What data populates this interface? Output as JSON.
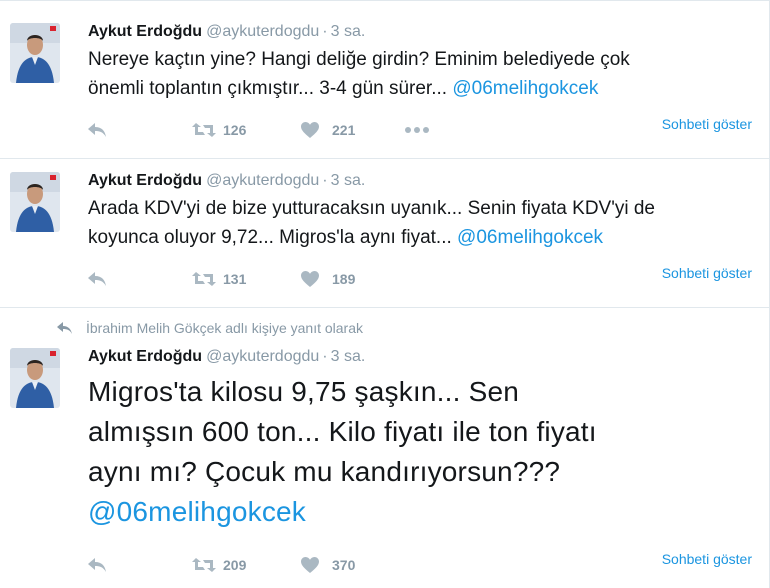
{
  "tweets": [
    {
      "author_name": "Aykut Erdoğdu",
      "author_handle": "@aykuterdogdu",
      "separator": "·",
      "time": "3 sa.",
      "text_lines": [
        "Nereye kaçtın yine? Hangi deliğe girdin? Eminim belediyede çok",
        "önemli toplantın çıkmıştır... 3-4 gün sürer... "
      ],
      "mention": "@06melihgokcek",
      "retweets": "126",
      "likes": "221",
      "conversation_link": "Sohbeti göster"
    },
    {
      "author_name": "Aykut Erdoğdu",
      "author_handle": "@aykuterdogdu",
      "separator": "·",
      "time": "3 sa.",
      "text_lines": [
        "Arada KDV'yi de bize yutturacaksın uyanık... Senin fiyata KDV'yi de",
        "koyunca oluyor 9,72... Migros'la aynı fiyat... "
      ],
      "mention": "@06melihgokcek",
      "retweets": "131",
      "likes": "189",
      "conversation_link": "Sohbeti göster"
    },
    {
      "reply_context": "İbrahim Melih Gökçek adlı kişiye yanıt olarak",
      "author_name": "Aykut Erdoğdu",
      "author_handle": "@aykuterdogdu",
      "separator": "·",
      "time": "3 sa.",
      "text_lines": [
        "Migros'ta kilosu 9,75 şaşkın... Sen",
        "almışsın 600 ton... Kilo fiyatı ile ton fiyatı",
        "aynı mı? Çocuk mu kandırıyorsun???"
      ],
      "mention": "@06melihgokcek",
      "retweets": "209",
      "likes": "370",
      "conversation_link": "Sohbeti göster"
    }
  ],
  "icons": {
    "reply": "reply-icon",
    "retweet": "retweet-icon",
    "like": "heart-icon",
    "more": "more-dots-icon",
    "reply_context": "reply-arrow-icon"
  },
  "colors": {
    "link": "#1b95e0",
    "muted": "#8899a6",
    "action": "#aab8c2",
    "text": "#14171a",
    "divider": "#e1e8ed"
  }
}
